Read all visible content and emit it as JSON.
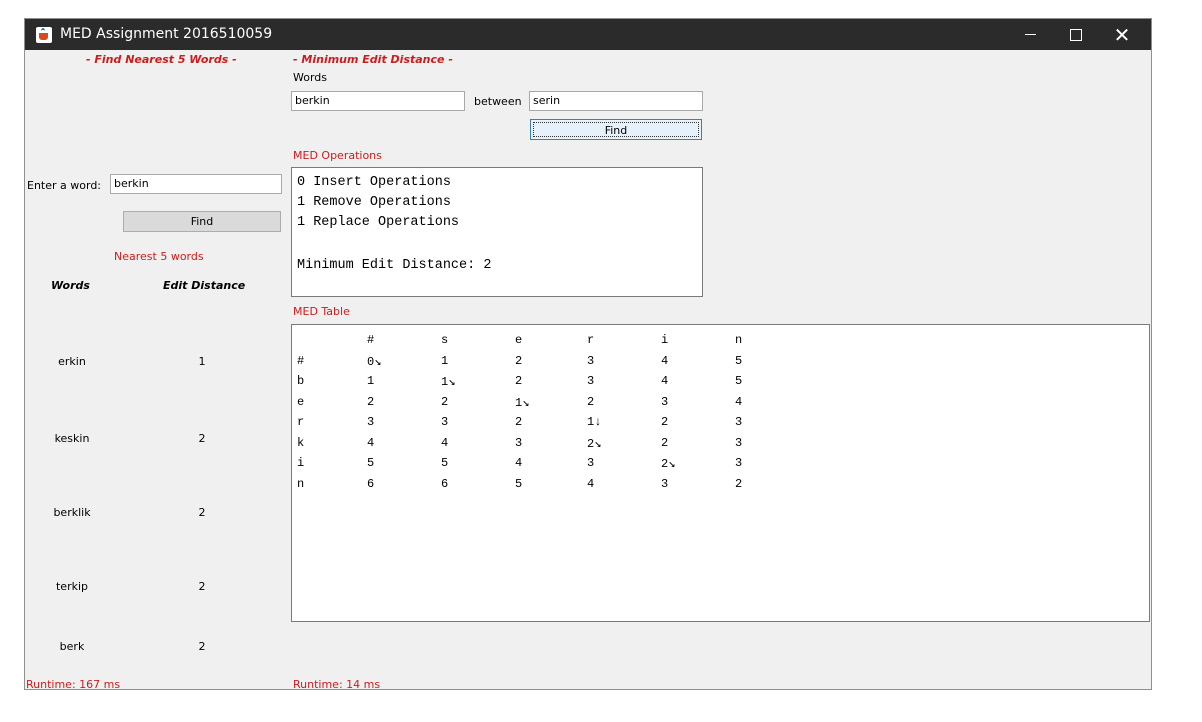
{
  "window": {
    "title": "MED Assignment 2016510059",
    "controls": {
      "minimize": "—",
      "maximize": "☐",
      "close": "✕"
    }
  },
  "left": {
    "heading": "- Find Nearest 5 Words -",
    "enter_label": "Enter a word:",
    "word_value": "berkin",
    "find_label": "Find",
    "nearest_label": "Nearest 5 words",
    "col_words": "Words",
    "col_edit": "Edit Distance",
    "results": [
      {
        "word": "erkin",
        "distance": "1"
      },
      {
        "word": "keskin",
        "distance": "2"
      },
      {
        "word": "berklik",
        "distance": "2"
      },
      {
        "word": "terkip",
        "distance": "2"
      },
      {
        "word": "berk",
        "distance": "2"
      }
    ],
    "runtime": "Runtime: 167 ms"
  },
  "right": {
    "heading": "- Minimum Edit Distance -",
    "words_label": "Words",
    "word1": "berkin",
    "between_label": "between",
    "word2": "serin",
    "find_label": "Find",
    "ops_label": "MED Operations",
    "ops": [
      "0 Insert Operations",
      "1 Remove Operations",
      "1 Replace Operations",
      "",
      "Minimum Edit Distance: 2"
    ],
    "table_label": "MED Table",
    "table": {
      "header": [
        "",
        "#",
        "s",
        "e",
        "r",
        "i",
        "n"
      ],
      "rows": [
        [
          "#",
          "0↘",
          "1",
          "2",
          "3",
          "4",
          "5"
        ],
        [
          "b",
          "1",
          "1↘",
          "2",
          "3",
          "4",
          "5"
        ],
        [
          "e",
          "2",
          "2",
          "1↘",
          "2",
          "3",
          "4"
        ],
        [
          "r",
          "3",
          "3",
          "2",
          "1↓",
          "2",
          "3"
        ],
        [
          "k",
          "4",
          "4",
          "3",
          "2↘",
          "2",
          "3"
        ],
        [
          "i",
          "5",
          "5",
          "4",
          "3",
          "2↘",
          "3"
        ],
        [
          "n",
          "6",
          "6",
          "5",
          "4",
          "3",
          "2"
        ]
      ]
    },
    "runtime": "Runtime: 14 ms"
  }
}
